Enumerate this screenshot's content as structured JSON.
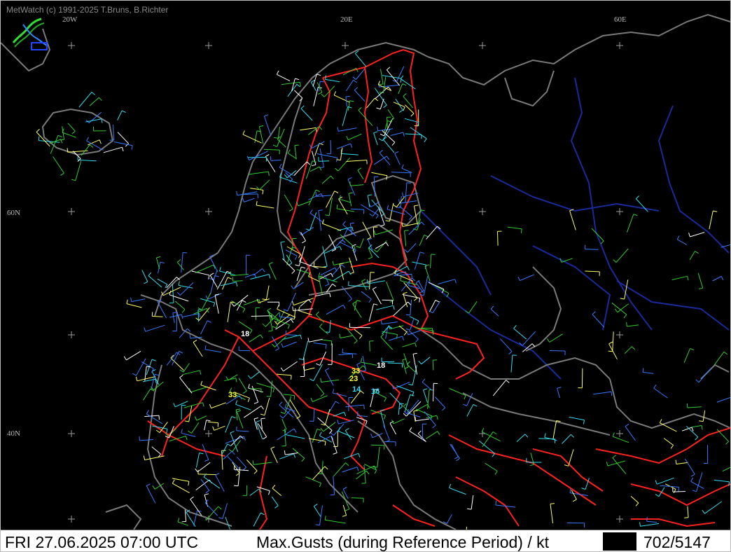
{
  "header": {
    "credit": "MetWatch  (c) 1991-2025 T.Bruns, B.Richter"
  },
  "logo": {
    "icon": "metwatch-logo-icon"
  },
  "grid_labels": {
    "lon_20w": "20W",
    "lon_20e": "20E",
    "lon_60e": "60E",
    "lat_60n": "60N",
    "lat_40n": "40N"
  },
  "gust_labels": [
    {
      "text": "18",
      "color": "#ffffff"
    },
    {
      "text": "33",
      "color": "#ffff33"
    },
    {
      "text": "18",
      "color": "#ffffff"
    },
    {
      "text": "23",
      "color": "#ffff33"
    },
    {
      "text": "14",
      "color": "#33ddff"
    },
    {
      "text": "16",
      "color": "#33ddff"
    },
    {
      "text": "33",
      "color": "#ffff33"
    }
  ],
  "status_bar": {
    "datetime": "FRI 27.06.2025 07:00 UTC",
    "parameter": "Max.Gusts (during Reference Period) / kt",
    "count": "702/5147"
  },
  "colors": {
    "background": "#000000",
    "coastline": "#7a7a7a",
    "border": "#ff2020",
    "river": "#1a2a9a",
    "barb_blue": "#3a7aff",
    "barb_green": "#33cc33",
    "barb_cyan": "#33ddee",
    "barb_white": "#ffffff",
    "barb_yellow": "#ffff66"
  }
}
